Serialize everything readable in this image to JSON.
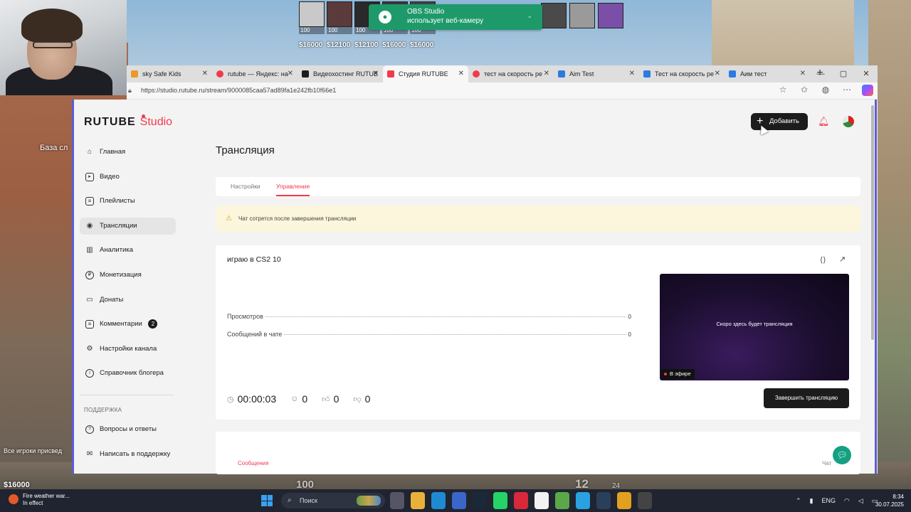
{
  "game": {
    "hud_players": [
      {
        "hp": "100",
        "money": "$16000"
      },
      {
        "hp": "100",
        "money": "$12100"
      },
      {
        "hp": "100",
        "money": "$12100"
      },
      {
        "hp": "100",
        "money": "$16000"
      },
      {
        "hp": "100",
        "money": "$16000"
      }
    ],
    "left_text_1": "База сл",
    "left_text_2": "Все игроки присвед",
    "left_money": "$16000",
    "bottom_hp": "100",
    "bottom_ammo": "12",
    "bottom_clip": "24"
  },
  "obs_toast": {
    "title": "OBS Studio",
    "message": "использует веб-камеру"
  },
  "browser": {
    "tabs": [
      {
        "label": "sky Safe Kids",
        "color": "#e89a2a",
        "active": false
      },
      {
        "label": "rutube — Яндекс: на",
        "color": "#f23a4d",
        "active": false
      },
      {
        "label": "Видеохостинг RUTUB",
        "color": "#1c1c1c",
        "active": false
      },
      {
        "label": "Студия RUTUBE",
        "color": "#f23a4d",
        "active": true
      },
      {
        "label": "тест на скорость ре",
        "color": "#f23a4d",
        "active": false
      },
      {
        "label": "Aim Test",
        "color": "#2b7be0",
        "active": false
      },
      {
        "label": "Тест на скорость ре",
        "color": "#2b7be0",
        "active": false
      },
      {
        "label": "Аим тест",
        "color": "#2b7be0",
        "active": false
      }
    ],
    "new_tab": "+",
    "url": "https://studio.rutube.ru/stream/9000085caa57ad89fa1e242fb10f66e1"
  },
  "studio": {
    "logo_main": "RUTUBE",
    "logo_sub": "Studio",
    "add_button": "Добавить",
    "page_title": "Трансляция",
    "sidebar": [
      {
        "label": "Главная",
        "icon": "home-icon",
        "glyph": "⌂"
      },
      {
        "label": "Видео",
        "icon": "video-icon",
        "glyph": "▸"
      },
      {
        "label": "Плейлисты",
        "icon": "playlist-icon",
        "glyph": "≡"
      },
      {
        "label": "Трансляции",
        "icon": "broadcast-icon",
        "glyph": "◉",
        "active": true
      },
      {
        "label": "Аналитика",
        "icon": "analytics-icon",
        "glyph": "▥"
      },
      {
        "label": "Монетизация",
        "icon": "monetization-icon",
        "glyph": "₽"
      },
      {
        "label": "Донаты",
        "icon": "donations-icon",
        "glyph": "▭"
      },
      {
        "label": "Комментарии",
        "icon": "comments-icon",
        "glyph": "≡",
        "badge": "2"
      },
      {
        "label": "Настройки канала",
        "icon": "settings-icon",
        "glyph": "⚙"
      },
      {
        "label": "Справочник блогера",
        "icon": "info-icon",
        "glyph": "i"
      }
    ],
    "support_title": "ПОДДЕРЖКА",
    "support_items": [
      {
        "label": "Вопросы и ответы",
        "icon": "faq-icon",
        "glyph": "?"
      },
      {
        "label": "Написать в поддержку",
        "icon": "mail-icon",
        "glyph": "✉"
      }
    ],
    "tabs": {
      "settings": "Настройки",
      "manage": "Управление"
    },
    "warning": "Чат сотрется после завершения трансляции",
    "stream": {
      "title": "играю в CS2 10",
      "views_label": "Просмотров",
      "views_value": "0",
      "messages_label": "Сообщений в чате",
      "messages_value": "0",
      "preview_text": "Скоро здесь будет трансляция",
      "live_label": "В эфире",
      "timer": "00:00:03",
      "viewers": "0",
      "likes": "0",
      "dislikes": "0",
      "end_button": "Завершить трансляцию"
    },
    "chat": {
      "messages_label": "Сообщения",
      "chat_label": "Чат"
    }
  },
  "taskbar": {
    "weather_title": "Fire weather war...",
    "weather_sub": "In effect",
    "search_placeholder": "Поиск",
    "lang": "ENG",
    "time": "8:34",
    "date": "30.07.2025"
  }
}
